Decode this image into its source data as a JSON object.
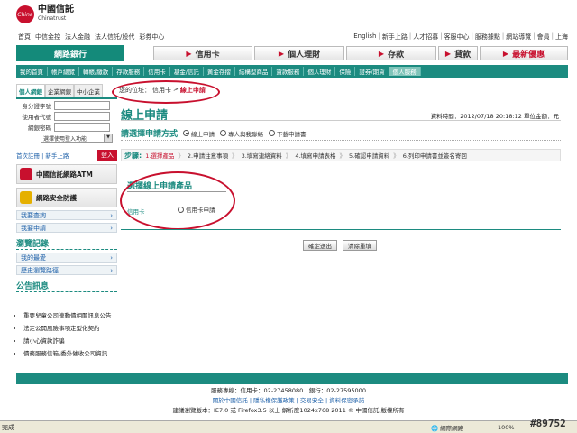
{
  "logo": {
    "seal_text": "China",
    "name": "中國信託",
    "name_en": "Chinatrust"
  },
  "topnav": [
    "首頁",
    "中信金控",
    "法人金融",
    "法人信託/股代",
    "彩券中心"
  ],
  "toplinks": [
    "English",
    "新手上路",
    "人才招募",
    "客服中心",
    "服務據點",
    "網站導覽",
    "會員",
    "上海"
  ],
  "main_tabs": {
    "bank": "網路銀行",
    "tabs": [
      {
        "label": "信用卡",
        "red": false
      },
      {
        "label": "個人理財",
        "red": false
      },
      {
        "label": "存款",
        "red": false
      },
      {
        "label": "貸款",
        "red": false
      },
      {
        "label": "最新優惠",
        "red": true
      }
    ]
  },
  "submenu": [
    "我的首頁",
    "帳戶總覽",
    "轉帳/繳款",
    "存款服務",
    "信用卡",
    "基金/信託",
    "黃金存摺",
    "結構型商品",
    "貸款服務",
    "個人理財",
    "保險",
    "證券/期貨",
    "個人服務"
  ],
  "sidebar": {
    "tabs": [
      "個人網銀",
      "企業網銀",
      "中小企業"
    ],
    "fields": [
      "身分證字號",
      "使用者代號",
      "網銀密碼"
    ],
    "select_value": "選擇使用登入功能",
    "first_use": "首次註冊 | 新手上路",
    "login": "登入",
    "box_atm": "中國信託網路ATM",
    "box_security": "網路安全防護",
    "links": [
      "我要查詢",
      "我要申請"
    ],
    "browse_title": "瀏覽記錄",
    "browse_links": [
      "我的最愛",
      "歷史瀏覽路徑"
    ],
    "notice_title": "公告訊息",
    "notices": [
      "重要兒童公司連動債相關訊息公告",
      "法定公開風險事項定型化契約",
      "請小心資款詐騙",
      "債務服務信箱/委外催收公司資訊"
    ]
  },
  "breadcrumb": {
    "prefix": "您的位址：",
    "mid": "信用卡",
    "sep": " > ",
    "current": "線上申請"
  },
  "page_title": "線上申請",
  "datetime": "資料時間：2012/07/18 20:18:12 單位金額：元",
  "method": {
    "label": "請選擇申請方式",
    "options": [
      {
        "label": "線上申請",
        "checked": true
      },
      {
        "label": "專人與我聯絡",
        "checked": false
      },
      {
        "label": "下載申請書",
        "checked": false
      }
    ]
  },
  "steps": {
    "label": "步驟:",
    "items": [
      "1.選擇產品",
      "2.申請注意事項",
      "3.填寫連絡資料",
      "4.填寫申請表格",
      "5.確認申請資料",
      "6.列印申請書並簽名寄回"
    ]
  },
  "product": {
    "title": "選擇線上申請產品",
    "category": "信用卡",
    "option": "信用卡申請"
  },
  "buttons": {
    "confirm": "確定送出",
    "clear": "清除重填"
  },
  "footer": {
    "line1_a": "服務專線：信用卡：02-27458080",
    "line1_b": "銀行：02-27595000",
    "line2": "關於中國信託 | 隱私權保護政策 | 交易安全 | 資料保密承諾",
    "line3": "建議瀏覽版本：IE7.0 或 Firefox3.5 以上 解析度1024x768 2011 © 中國信託 版權所有"
  },
  "statusbar": {
    "left": "完成",
    "zone": "網際網路",
    "zoom": "100%"
  },
  "watermark": "#89752",
  "colors": {
    "accent": "#1c8b80",
    "brand_red": "#c8102e"
  }
}
